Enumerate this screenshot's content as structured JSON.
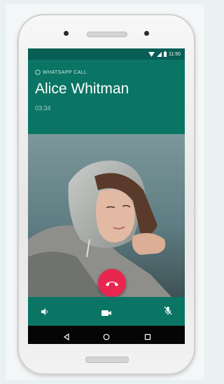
{
  "status_bar": {
    "time": "11:50",
    "icons": [
      "wifi-icon",
      "signal-icon",
      "battery-icon"
    ]
  },
  "call": {
    "app_label": "WHATSAPP CALL",
    "contact_name": "Alice Whitman",
    "duration": "03:34"
  },
  "controls": {
    "speaker_icon": "speaker-icon",
    "video_icon": "video-camera-icon",
    "mute_icon": "mute-microphone-icon",
    "end_call_icon": "end-call-icon"
  },
  "nav_bar": {
    "buttons": [
      "back-icon",
      "home-icon",
      "recents-icon"
    ]
  },
  "colors": {
    "header": "#0b7565",
    "status_bar": "#075e54",
    "end_call": "#e8264f"
  }
}
